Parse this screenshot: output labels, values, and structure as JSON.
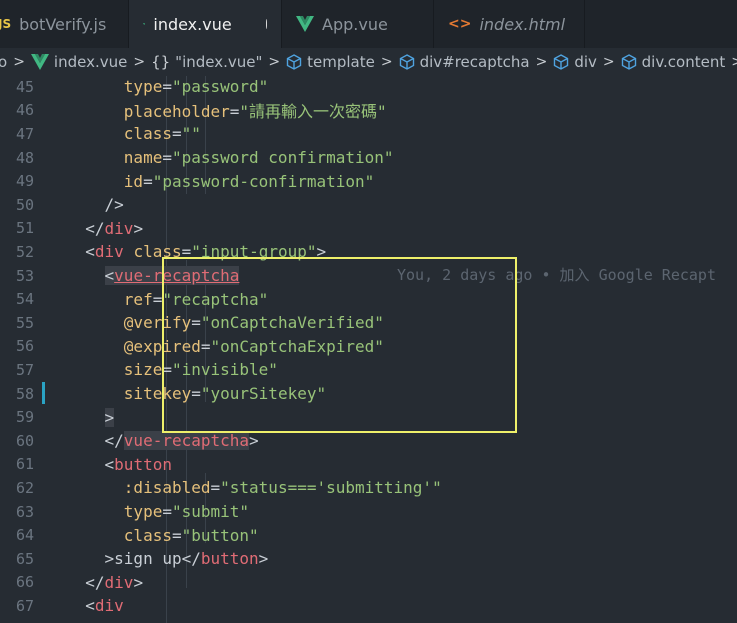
{
  "tabs": [
    {
      "label": "botVerify.js",
      "badge": "JS",
      "active": false
    },
    {
      "label": "index.vue",
      "active": true,
      "modified": true
    },
    {
      "label": "App.vue",
      "active": false
    },
    {
      "label": "index.html",
      "badge": "<>",
      "active": false
    }
  ],
  "breadcrumb": {
    "start": "o",
    "file": "index.vue",
    "braces": "{}",
    "scope": "\"index.vue\"",
    "template": "template",
    "div_recaptcha": "div#recaptcha",
    "div": "div",
    "div_content": "div.content"
  },
  "lines": [
    {
      "n": "45",
      "indent": "      ",
      "attr": "type",
      "value": "\"password\""
    },
    {
      "n": "46",
      "indent": "      ",
      "attr": "placeholder",
      "value": "\"請再輸入一次密碼\""
    },
    {
      "n": "47",
      "indent": "      ",
      "attr": "class",
      "value": "\"\""
    },
    {
      "n": "48",
      "indent": "      ",
      "attr": "name",
      "value": "\"password confirmation\""
    },
    {
      "n": "49",
      "indent": "      ",
      "attr": "id",
      "value": "\"password-confirmation\""
    },
    {
      "n": "50",
      "indent": "    ",
      "text": "/>"
    },
    {
      "n": "51",
      "indent": "  ",
      "close_tag": "div"
    },
    {
      "n": "52",
      "indent": "  ",
      "open_tag": "div",
      "attr": "class",
      "value": "\"input-group\"",
      "tail": ">"
    },
    {
      "n": "53",
      "indent": "    ",
      "open_tag": "vue-recaptcha",
      "highlight_tag": true
    },
    {
      "n": "54",
      "indent": "      ",
      "attr": "ref",
      "value": "\"recaptcha\""
    },
    {
      "n": "55",
      "indent": "      ",
      "attr": "@verify",
      "value": "\"onCaptchaVerified\""
    },
    {
      "n": "56",
      "indent": "      ",
      "attr": "@expired",
      "value": "\"onCaptchaExpired\""
    },
    {
      "n": "57",
      "indent": "      ",
      "attr": "size",
      "value": "\"invisible\""
    },
    {
      "n": "58",
      "indent": "      ",
      "attr": "sitekey",
      "value": "\"yourSitekey\"",
      "modified": true
    },
    {
      "n": "59",
      "indent": "    ",
      "text": ">",
      "highlight_text": true
    },
    {
      "n": "60",
      "indent": "    ",
      "close_tag": "vue-recaptcha",
      "highlight_tag": true
    },
    {
      "n": "61",
      "indent": "    ",
      "open_tag": "button"
    },
    {
      "n": "62",
      "indent": "      ",
      "attr": ":disabled",
      "value": "\"status==='submitting'\""
    },
    {
      "n": "63",
      "indent": "      ",
      "attr": "type",
      "value": "\"submit\""
    },
    {
      "n": "64",
      "indent": "      ",
      "attr": "class",
      "value": "\"button\""
    },
    {
      "n": "65",
      "indent": "    ",
      "text": ">sign up",
      "close_tag_inline": "button"
    },
    {
      "n": "66",
      "indent": "  ",
      "close_tag": "div"
    },
    {
      "n": "67",
      "indent": "  ",
      "open_tag": "div"
    }
  ],
  "blame": {
    "text": "You, 2 days ago • 加入 Google Recapt",
    "line": "53"
  },
  "colors": {
    "background": "#262c33",
    "tag": "#e06c75",
    "attribute": "#e5c07b",
    "string": "#98c379",
    "highlight_box": "#eef06a",
    "modified_gutter": "#2aa3c4"
  }
}
